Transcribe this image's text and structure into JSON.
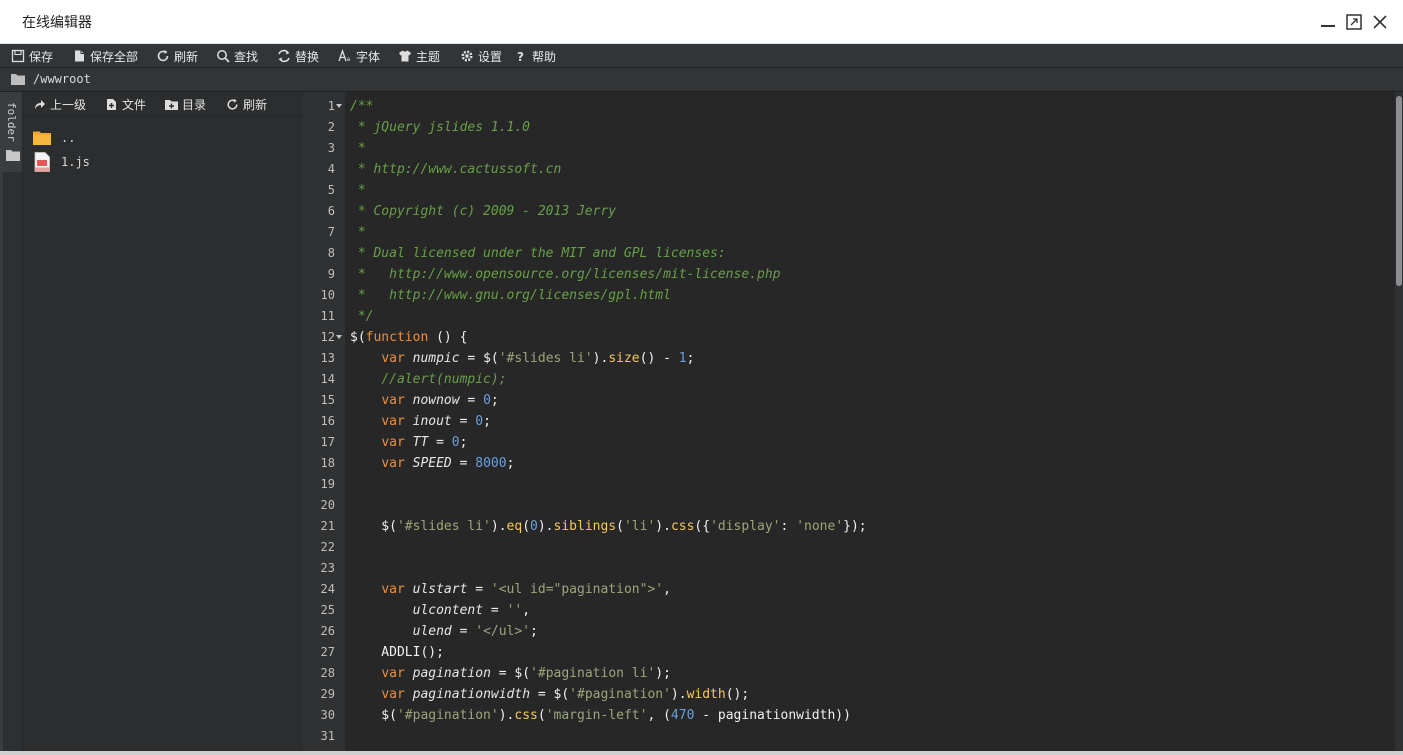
{
  "window": {
    "title": "在线编辑器",
    "controls": [
      "minimize-icon",
      "maximize-icon",
      "close-icon"
    ]
  },
  "toolbar": {
    "items": [
      {
        "label": "保存",
        "icon": "save-icon"
      },
      {
        "label": "保存全部",
        "icon": "save-all-icon"
      },
      {
        "label": "刷新",
        "icon": "refresh-icon"
      },
      {
        "label": "查找",
        "icon": "search-icon"
      },
      {
        "label": "替换",
        "icon": "replace-icon"
      },
      {
        "label": "字体",
        "icon": "font-icon"
      },
      {
        "label": "主题",
        "icon": "theme-icon"
      },
      {
        "label": "设置",
        "icon": "gear-icon"
      },
      {
        "label": "帮助",
        "icon": "help-icon"
      }
    ]
  },
  "path": "/wwwroot",
  "side_tab": {
    "label": "folder",
    "icon": "folder-icon"
  },
  "sidebar": {
    "toolbar": [
      {
        "label": "上一级",
        "icon": "up-arrow-icon"
      },
      {
        "label": "文件",
        "icon": "new-file-icon"
      },
      {
        "label": "目录",
        "icon": "new-folder-icon"
      },
      {
        "label": "刷新",
        "icon": "refresh-icon"
      }
    ],
    "files": [
      {
        "name": "..",
        "icon": "folder-icon"
      },
      {
        "name": "1.js",
        "icon": "js-file-icon"
      }
    ]
  },
  "editor": {
    "folded_lines": [
      1,
      12
    ],
    "lines": [
      [
        [
          "cm",
          "/**"
        ]
      ],
      [
        [
          "cm",
          " * jQuery jslides 1.1.0"
        ]
      ],
      [
        [
          "cm",
          " *"
        ]
      ],
      [
        [
          "cm",
          " * http://www.cactussoft.cn"
        ]
      ],
      [
        [
          "cm",
          " *"
        ]
      ],
      [
        [
          "cm",
          " * Copyright (c) 2009 - 2013 Jerry"
        ]
      ],
      [
        [
          "cm",
          " *"
        ]
      ],
      [
        [
          "cm",
          " * Dual licensed under the MIT and GPL licenses:"
        ]
      ],
      [
        [
          "cm",
          " *   http://www.opensource.org/licenses/mit-license.php"
        ]
      ],
      [
        [
          "cm",
          " *   http://www.gnu.org/licenses/gpl.html"
        ]
      ],
      [
        [
          "cm",
          " */"
        ]
      ],
      [
        [
          "",
          "$("
        ],
        [
          "kw",
          "function"
        ],
        [
          "",
          " () {"
        ]
      ],
      [
        [
          "",
          "    "
        ],
        [
          "kw",
          "var"
        ],
        [
          "",
          " "
        ],
        [
          "it",
          "numpic"
        ],
        [
          "",
          " = $("
        ],
        [
          "str",
          "'#slides li'"
        ],
        [
          "",
          ")."
        ],
        [
          "fn",
          "size"
        ],
        [
          "",
          "() - "
        ],
        [
          "num",
          "1"
        ],
        [
          "",
          ";"
        ]
      ],
      [
        [
          "",
          "    "
        ],
        [
          "cm",
          "//alert(numpic);"
        ]
      ],
      [
        [
          "",
          "    "
        ],
        [
          "kw",
          "var"
        ],
        [
          "",
          " "
        ],
        [
          "it",
          "nownow"
        ],
        [
          "",
          " = "
        ],
        [
          "num",
          "0"
        ],
        [
          "",
          ";"
        ]
      ],
      [
        [
          "",
          "    "
        ],
        [
          "kw",
          "var"
        ],
        [
          "",
          " "
        ],
        [
          "it",
          "inout"
        ],
        [
          "",
          " = "
        ],
        [
          "num",
          "0"
        ],
        [
          "",
          ";"
        ]
      ],
      [
        [
          "",
          "    "
        ],
        [
          "kw",
          "var"
        ],
        [
          "",
          " "
        ],
        [
          "it",
          "TT"
        ],
        [
          "",
          " = "
        ],
        [
          "num",
          "0"
        ],
        [
          "",
          ";"
        ]
      ],
      [
        [
          "",
          "    "
        ],
        [
          "kw",
          "var"
        ],
        [
          "",
          " "
        ],
        [
          "it",
          "SPEED"
        ],
        [
          "",
          " = "
        ],
        [
          "num",
          "8000"
        ],
        [
          "",
          ";"
        ]
      ],
      [
        [
          "",
          ""
        ]
      ],
      [
        [
          "",
          ""
        ]
      ],
      [
        [
          "",
          "    $("
        ],
        [
          "str",
          "'#slides li'"
        ],
        [
          "",
          ")."
        ],
        [
          "fn",
          "eq"
        ],
        [
          "",
          "("
        ],
        [
          "num",
          "0"
        ],
        [
          "",
          ")."
        ],
        [
          "fn",
          "siblings"
        ],
        [
          "",
          "("
        ],
        [
          "str",
          "'li'"
        ],
        [
          "",
          ")."
        ],
        [
          "fn",
          "css"
        ],
        [
          "",
          "({"
        ],
        [
          "str",
          "'display'"
        ],
        [
          "",
          ": "
        ],
        [
          "str",
          "'none'"
        ],
        [
          "",
          "});"
        ]
      ],
      [
        [
          "",
          ""
        ]
      ],
      [
        [
          "",
          ""
        ]
      ],
      [
        [
          "",
          "    "
        ],
        [
          "kw",
          "var"
        ],
        [
          "",
          " "
        ],
        [
          "it",
          "ulstart"
        ],
        [
          "",
          " = "
        ],
        [
          "str",
          "'<ul id=\"pagination\">'"
        ],
        [
          "",
          ","
        ]
      ],
      [
        [
          "",
          "        "
        ],
        [
          "it",
          "ulcontent"
        ],
        [
          "",
          " = "
        ],
        [
          "str",
          "''"
        ],
        [
          "",
          ","
        ]
      ],
      [
        [
          "",
          "        "
        ],
        [
          "it",
          "ulend"
        ],
        [
          "",
          " = "
        ],
        [
          "str",
          "'</ul>'"
        ],
        [
          "",
          ";"
        ]
      ],
      [
        [
          "",
          "    ADDLI();"
        ]
      ],
      [
        [
          "",
          "    "
        ],
        [
          "kw",
          "var"
        ],
        [
          "",
          " "
        ],
        [
          "it",
          "pagination"
        ],
        [
          "",
          " = $("
        ],
        [
          "str",
          "'#pagination li'"
        ],
        [
          "",
          ");"
        ]
      ],
      [
        [
          "",
          "    "
        ],
        [
          "kw",
          "var"
        ],
        [
          "",
          " "
        ],
        [
          "it",
          "paginationwidth"
        ],
        [
          "",
          " = $("
        ],
        [
          "str",
          "'#pagination'"
        ],
        [
          "",
          ")."
        ],
        [
          "fn",
          "width"
        ],
        [
          "",
          "();"
        ]
      ],
      [
        [
          "",
          "    $("
        ],
        [
          "str",
          "'#pagination'"
        ],
        [
          "",
          ")."
        ],
        [
          "fn",
          "css"
        ],
        [
          "",
          "("
        ],
        [
          "str",
          "'margin-left'"
        ],
        [
          "",
          ", ("
        ],
        [
          "num",
          "470"
        ],
        [
          "",
          " - paginationwidth))"
        ]
      ],
      [
        [
          "",
          ""
        ]
      ]
    ]
  },
  "colors": {
    "comment": "#67a047",
    "keyword": "#ef8f3a",
    "string": "#9aa679",
    "number": "#6ba0d8",
    "function": "#f7c85a",
    "folder": "#f0a830"
  }
}
